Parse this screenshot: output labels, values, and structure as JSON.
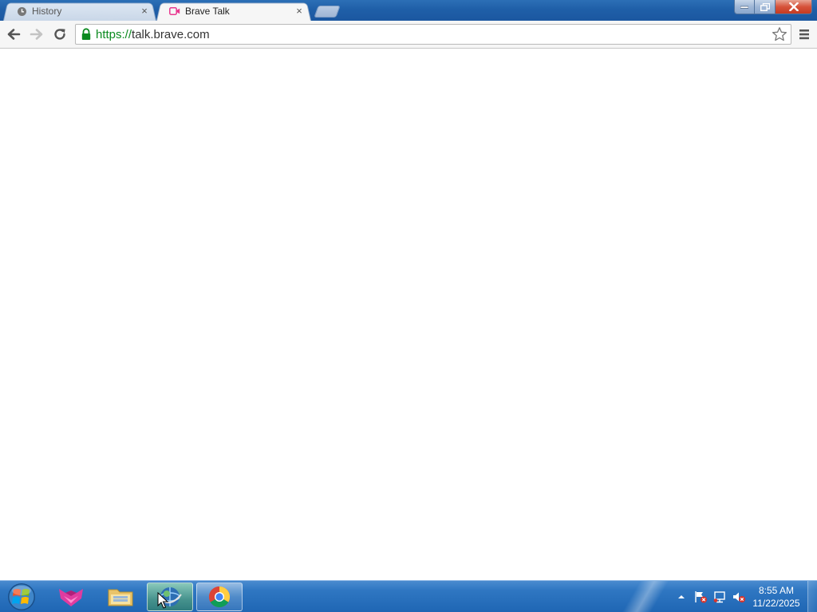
{
  "browser": {
    "tabs": [
      {
        "title": "History",
        "favicon": "history-clock-icon",
        "active": false,
        "close_label": "×"
      },
      {
        "title": "Brave Talk",
        "favicon": "video-camera-icon",
        "active": true,
        "close_label": "×"
      }
    ],
    "address": {
      "scheme": "https://",
      "host": "talk.brave.com"
    }
  },
  "taskbar": {
    "pinned": [
      {
        "name": "start-orb-icon"
      },
      {
        "name": "app-fox-icon"
      },
      {
        "name": "file-explorer-icon"
      },
      {
        "name": "ie-globe-icon"
      },
      {
        "name": "chrome-icon"
      }
    ],
    "clock": {
      "time": "8:55 AM",
      "date": "11/22/2025"
    }
  },
  "colors": {
    "url_scheme": "#0b8a1f",
    "taskbar": "#2f77c2",
    "titlebar": "#1f5fa8"
  }
}
